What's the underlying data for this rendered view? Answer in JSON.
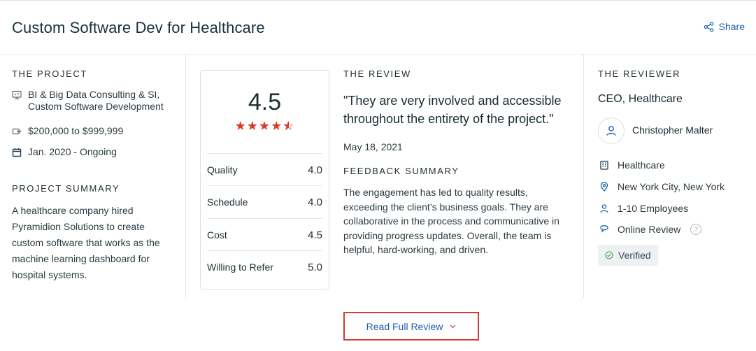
{
  "header": {
    "title": "Custom Software Dev for Healthcare",
    "share_label": "Share"
  },
  "project": {
    "section_label": "THE PROJECT",
    "services": "BI & Big Data Consulting & SI, Custom Software Development",
    "budget": "$200,000 to $999,999",
    "timeline": "Jan. 2020 - Ongoing",
    "summary_label": "PROJECT SUMMARY",
    "summary_text": "A healthcare company hired Pyramidion Solutions to create custom software that works as the machine learning dashboard for hospital systems.",
    "icons": [
      "monitor-icon",
      "tag-icon",
      "calendar-icon"
    ]
  },
  "rating": {
    "overall": "4.5",
    "stars": 4.5,
    "star_color": "#d93a2b",
    "rows": [
      {
        "label": "Quality",
        "value": "4.0"
      },
      {
        "label": "Schedule",
        "value": "4.0"
      },
      {
        "label": "Cost",
        "value": "4.5"
      },
      {
        "label": "Willing to Refer",
        "value": "5.0"
      }
    ]
  },
  "review": {
    "section_label": "THE REVIEW",
    "quote": "\"They are very involved and accessible throughout the entirety of the project.\"",
    "date": "May 18, 2021",
    "feedback_label": "FEEDBACK SUMMARY",
    "feedback_text": "The engagement has led to quality results, exceeding the client’s business goals. They are collaborative in the process and communicative in providing progress updates. Overall, the team is helpful, hard-working, and driven."
  },
  "reviewer": {
    "section_label": "THE REVIEWER",
    "role": "CEO, Healthcare",
    "name": "Christopher Malter",
    "industry": "Healthcare",
    "location": "New York City, New York",
    "employees": "1-10 Employees",
    "review_type": "Online Review",
    "help_glyph": "?",
    "verified_label": "Verified",
    "icons": [
      "building-icon",
      "location-pin-icon",
      "user-icon",
      "chat-bubble-icon",
      "check-circle-icon"
    ]
  },
  "actions": {
    "read_full_review": "Read Full Review"
  },
  "colors": {
    "accent_link": "#1a5fb4",
    "button_border": "#d43c32",
    "divider": "#e3e8ee"
  }
}
